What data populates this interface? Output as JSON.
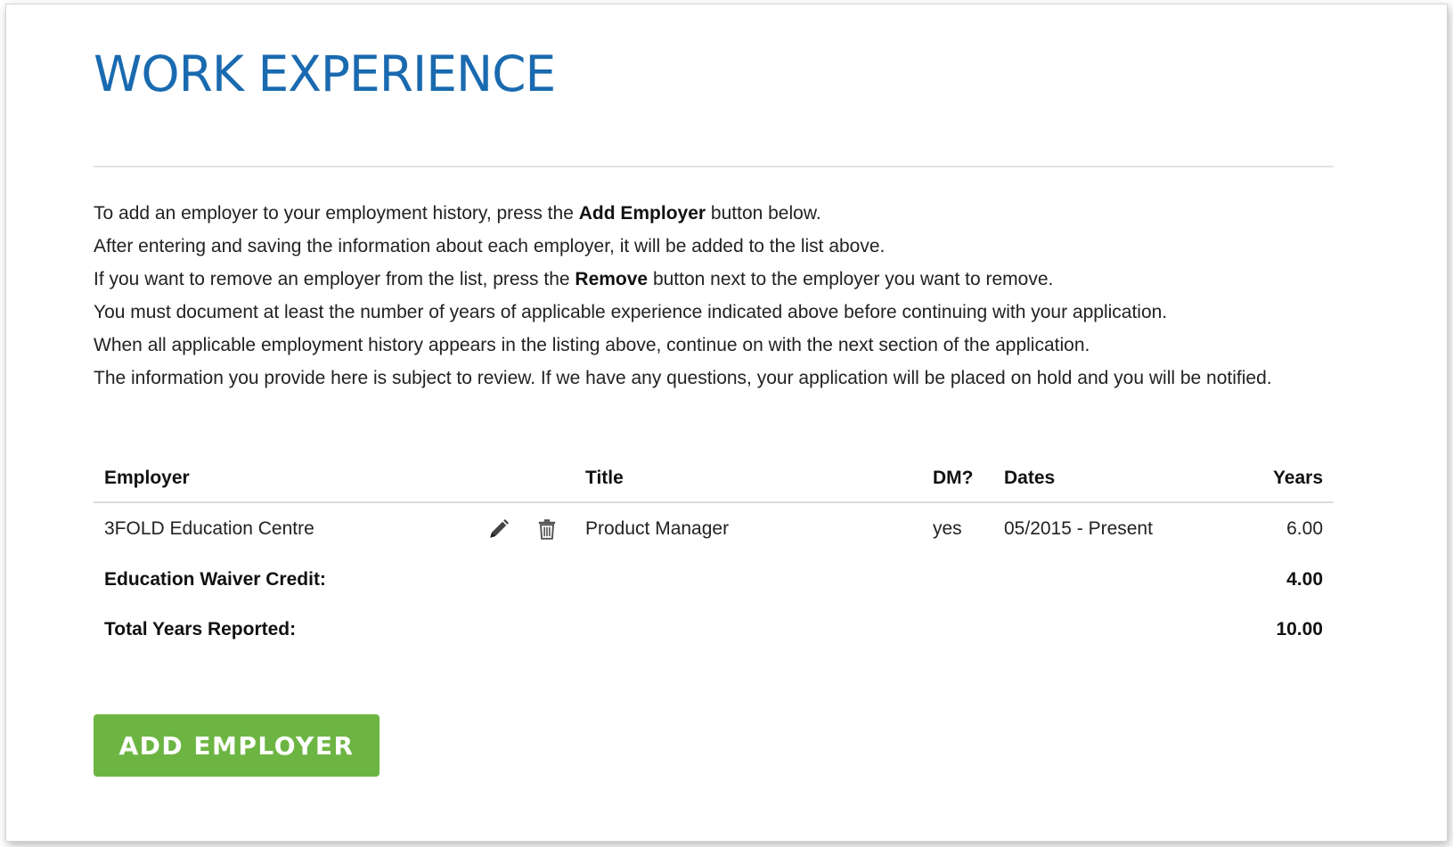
{
  "page": {
    "title": "WORK EXPERIENCE"
  },
  "instructions": {
    "line1": {
      "before": "To add an employer to your employment history, press the ",
      "bold": "Add Employer",
      "after": " button below."
    },
    "line2": "After entering and saving the information about each employer, it will be added to the list above.",
    "line3": {
      "before": "If you want to remove an employer from the list, press the ",
      "bold": "Remove",
      "after": " button next to the employer you want to remove."
    },
    "line4": "You must document at least the number of years of applicable experience indicated above before continuing with your application.",
    "line5": "When all applicable employment history appears in the listing above, continue on with the next section of the application.",
    "line6": "The information you provide here is subject to review. If we have any questions, your application will be placed on hold and you will be notified."
  },
  "table": {
    "headers": {
      "employer": "Employer",
      "title": "Title",
      "dm": "DM?",
      "dates": "Dates",
      "years": "Years"
    },
    "rows": [
      {
        "employer": "3FOLD Education Centre",
        "title": "Product Manager",
        "dm": "yes",
        "dates": "05/2015 - Present",
        "years": "6.00",
        "edit_icon": "pencil-icon",
        "remove_icon": "trash-icon"
      }
    ],
    "education_waiver": {
      "label": "Education Waiver Credit:",
      "value": "4.00"
    },
    "total": {
      "label": "Total Years Reported:",
      "value": "10.00"
    }
  },
  "actions": {
    "add_employer_label": "ADD EMPLOYER"
  },
  "colors": {
    "title": "#1a6ab0",
    "button": "#6db543",
    "text": "#222222"
  }
}
